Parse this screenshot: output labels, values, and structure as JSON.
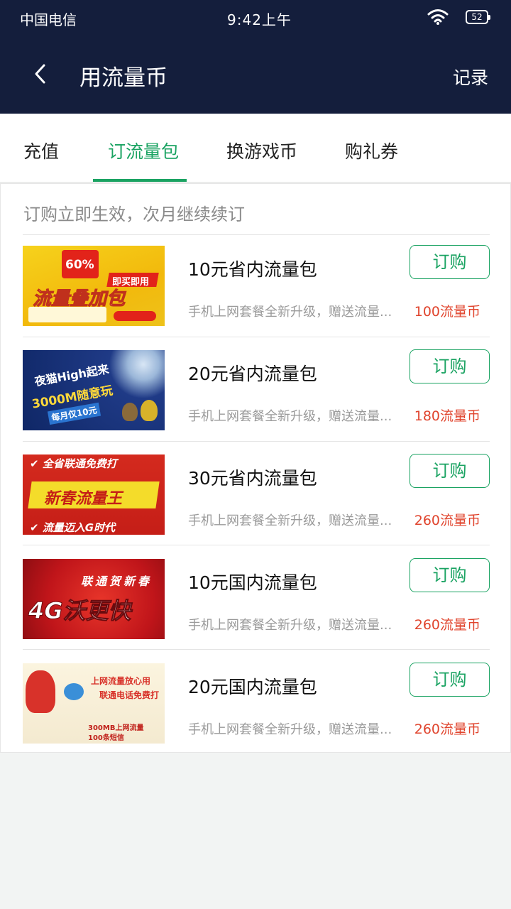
{
  "status_bar": {
    "carrier": "中国电信",
    "time": "9:42上午",
    "battery": "52"
  },
  "header": {
    "title": "用流量币",
    "record_label": "记录"
  },
  "tabs": [
    {
      "label": "充值",
      "active": false
    },
    {
      "label": "订流量包",
      "active": true
    },
    {
      "label": "换游戏币",
      "active": false
    },
    {
      "label": "购礼券",
      "active": false
    }
  ],
  "notice": "订购立即生效，次月继续续订",
  "subscribe_label": "订购",
  "items": [
    {
      "title": "10元省内流量包",
      "desc": "手机上网套餐全新升级，赠送流量...",
      "price": "100流量币",
      "banner": {
        "line1": "60%",
        "line2": "即买即用",
        "line3": "流量叠加包"
      }
    },
    {
      "title": "20元省内流量包",
      "desc": "手机上网套餐全新升级，赠送流量...",
      "price": "180流量币",
      "banner": {
        "line1": "夜猫High起来",
        "line2": "3000M随意玩",
        "line3": "每月仅10元"
      }
    },
    {
      "title": "30元省内流量包",
      "desc": "手机上网套餐全新升级，赠送流量...",
      "price": "260流量币",
      "banner": {
        "line1": "✔ 全省联通免费打",
        "line2": "新春流量王",
        "line3": "✔ 流量迈入G时代"
      }
    },
    {
      "title": "10元国内流量包",
      "desc": "手机上网套餐全新升级，赠送流量...",
      "price": "260流量币",
      "banner": {
        "line1": "联通贺新春",
        "line2": "4G沃更快"
      }
    },
    {
      "title": "20元国内流量包",
      "desc": "手机上网套餐全新升级，赠送流量...",
      "price": "260流量币",
      "banner": {
        "line1": "上网流量放心用",
        "line2": "联通电话免费打",
        "line3": "300MB上网流量",
        "line4": "100条短信"
      }
    }
  ],
  "colors": {
    "header_bg": "#141e3c",
    "accent": "#1aa362",
    "price": "#e0442d"
  }
}
